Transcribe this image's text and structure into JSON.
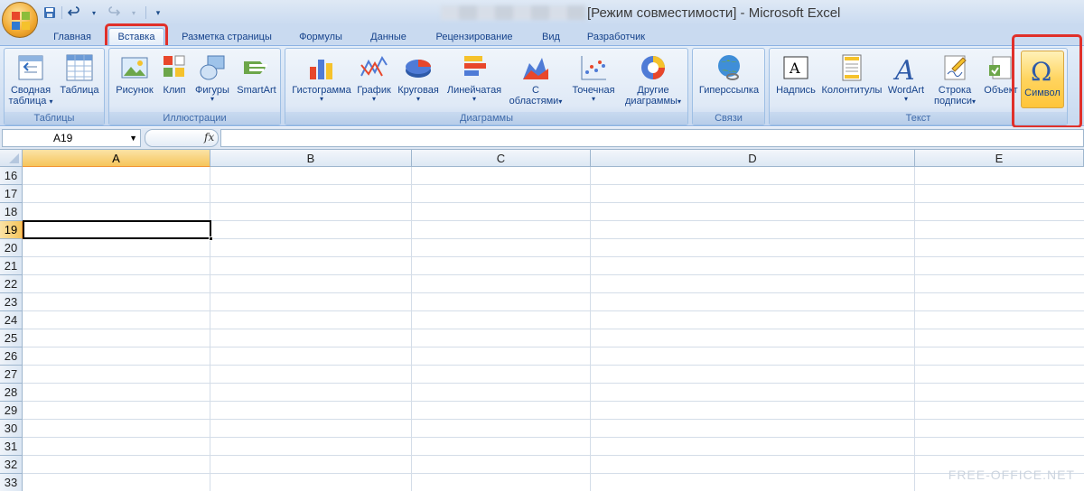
{
  "window": {
    "title": "[Режим совместимости] - Microsoft Excel"
  },
  "qat": {
    "icons": [
      "save-icon",
      "undo-icon",
      "redo-icon",
      "customize-icon"
    ]
  },
  "tabs": [
    {
      "label": "Главная"
    },
    {
      "label": "Вставка",
      "active": true
    },
    {
      "label": "Разметка страницы"
    },
    {
      "label": "Формулы"
    },
    {
      "label": "Данные"
    },
    {
      "label": "Рецензирование"
    },
    {
      "label": "Вид"
    },
    {
      "label": "Разработчик"
    }
  ],
  "groups": {
    "tables": {
      "label": "Таблицы",
      "pivot_line1": "Сводная",
      "pivot_line2": "таблица",
      "table": "Таблица"
    },
    "illustrations": {
      "label": "Иллюстрации",
      "picture": "Рисунок",
      "clip": "Клип",
      "shapes": "Фигуры",
      "smartart": "SmartArt"
    },
    "charts": {
      "label": "Диаграммы",
      "column": "Гистограмма",
      "line": "График",
      "pie": "Круговая",
      "bar": "Линейчатая",
      "area_line1": "С",
      "area_line2": "областями",
      "scatter": "Точечная",
      "other_line1": "Другие",
      "other_line2": "диаграммы"
    },
    "links": {
      "label": "Связи",
      "hyperlink": "Гиперссылка"
    },
    "text": {
      "label": "Текст",
      "textbox": "Надпись",
      "headerfooter": "Колонтитулы",
      "wordart": "WordArt",
      "signature_line1": "Строка",
      "signature_line2": "подписи",
      "object": "Объект",
      "symbol": "Символ"
    }
  },
  "formula_bar": {
    "name_box": "A19",
    "fx": "fx",
    "formula": ""
  },
  "sheet": {
    "columns": [
      "A",
      "B",
      "C",
      "D",
      "E"
    ],
    "selected_column": "A",
    "rows": [
      "16",
      "17",
      "18",
      "19",
      "20",
      "21",
      "22",
      "23",
      "24",
      "25",
      "26",
      "27",
      "28",
      "29",
      "30",
      "31",
      "32",
      "33"
    ],
    "selected_row": "19",
    "active_cell": "A19"
  },
  "watermark": "FREE-OFFICE.NET",
  "colors": {
    "highlight": "#e0302a",
    "ribbon_text": "#15428b",
    "selected_header": "#f6c55c"
  }
}
